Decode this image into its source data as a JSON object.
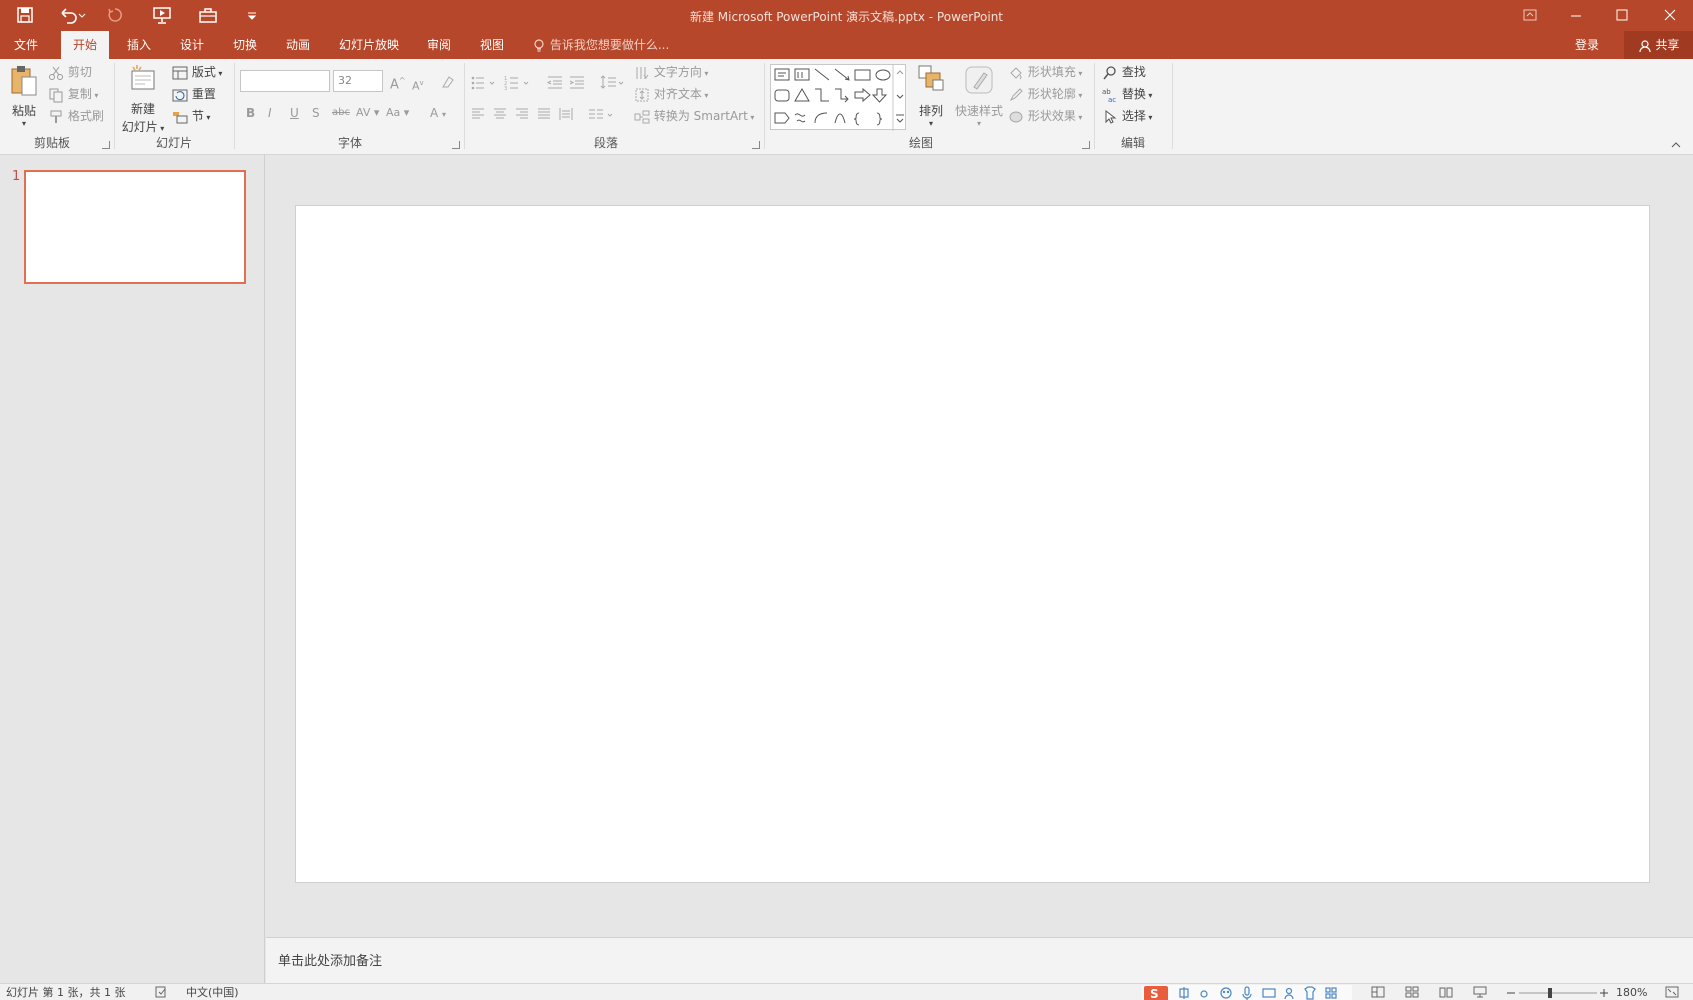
{
  "window": {
    "title": "新建 Microsoft PowerPoint 演示文稿.pptx - PowerPoint",
    "accent": "#b7472a"
  },
  "tabs": [
    "文件",
    "开始",
    "插入",
    "设计",
    "切换",
    "动画",
    "幻灯片放映",
    "审阅",
    "视图"
  ],
  "active_tab": "开始",
  "tell_me": "告诉我您想要做什么...",
  "login": "登录",
  "share": "共享",
  "ribbon": {
    "clipboard": {
      "label": "剪贴板",
      "paste": "粘贴",
      "cut": "剪切",
      "copy": "复制",
      "painter": "格式刷"
    },
    "slides": {
      "label": "幻灯片",
      "new_slide_1": "新建",
      "new_slide_2": "幻灯片",
      "layout": "版式",
      "reset": "重置",
      "section": "节"
    },
    "font": {
      "label": "字体",
      "font_name": "",
      "font_size": "32"
    },
    "paragraph": {
      "label": "段落",
      "text_direction": "文字方向",
      "align_text": "对齐文本",
      "smartart": "转换为 SmartArt"
    },
    "drawing": {
      "label": "绘图",
      "arrange": "排列",
      "quick_styles": "快速样式",
      "shape_fill": "形状填充",
      "shape_outline": "形状轮廓",
      "shape_effects": "形状效果"
    },
    "editing": {
      "label": "编辑",
      "find": "查找",
      "replace": "替换",
      "select": "选择"
    }
  },
  "thumbnails": [
    {
      "number": "1"
    }
  ],
  "notes_placeholder": "单击此处添加备注",
  "status": {
    "slide_info": "幻灯片 第 1 张，共 1 张",
    "language": "中文(中国)",
    "zoom": "180%"
  }
}
